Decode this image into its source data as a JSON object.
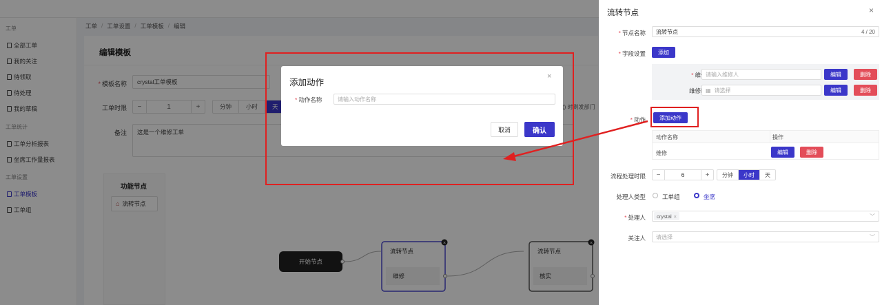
{
  "sidebar": {
    "groups": [
      "工单",
      "工单统计",
      "工单设置"
    ],
    "items": [
      "全部工单",
      "我的关注",
      "待领取",
      "待处理",
      "我的草稿",
      "工单分析报表",
      "坐席工作量报表",
      "工单模板",
      "工单组"
    ],
    "active": "工单模板"
  },
  "breadcrumb": [
    "工单",
    "工单设置",
    "工单模板",
    "编辑"
  ],
  "page": {
    "title": "编辑模板",
    "template_name_label": "模板名称",
    "template_name_value": "crystal工单模板",
    "time_label": "工单时限",
    "time_value": "1",
    "time_units": [
      "分钟",
      "小时",
      "天"
    ],
    "remark_label": "备注",
    "remark_value": "这是一个维修工单",
    "side_note": "() 时刷发部门"
  },
  "function_panel": {
    "title": "功能节点",
    "node": "流转节点"
  },
  "flow": {
    "start": "开始节点",
    "node1_title": "流转节点",
    "node1_action": "维修",
    "node2_title": "流转节点",
    "node2_action": "核实"
  },
  "modal": {
    "title": "添加动作",
    "field_label": "动作名称",
    "field_placeholder": "请输入动作名称",
    "cancel": "取消",
    "confirm": "确认",
    "close": "×"
  },
  "drawer": {
    "title": "流转节点",
    "close": "×",
    "node_name_label": "节点名称",
    "node_name_value": "流转节点",
    "node_name_count": "4 / 20",
    "field_setting_label": "字段设置",
    "add_label": "添加",
    "fields": [
      {
        "label": "维修人",
        "placeholder": "请输入维修人",
        "required": true
      },
      {
        "label": "维修时间",
        "placeholder": "请选择",
        "required": false
      }
    ],
    "edit_label": "编辑",
    "delete_label": "删除",
    "action_label": "动作",
    "add_action_label": "添加动作",
    "table_headers": [
      "动作名称",
      "操作"
    ],
    "table_rows": [
      {
        "name": "维修"
      }
    ],
    "process_time_label": "流程处理时限",
    "process_time_value": "6",
    "units": [
      "分钟",
      "小时",
      "天"
    ],
    "handler_type_label": "处理人类型",
    "handler_types": [
      "工单组",
      "坐席"
    ],
    "handler_label": "处理人",
    "handler_tag": "crystal",
    "follower_label": "关注人",
    "follower_placeholder": "请选择"
  },
  "colors": {
    "primary": "#3b37c9",
    "danger": "#e34d59",
    "highlight": "#e02020"
  }
}
